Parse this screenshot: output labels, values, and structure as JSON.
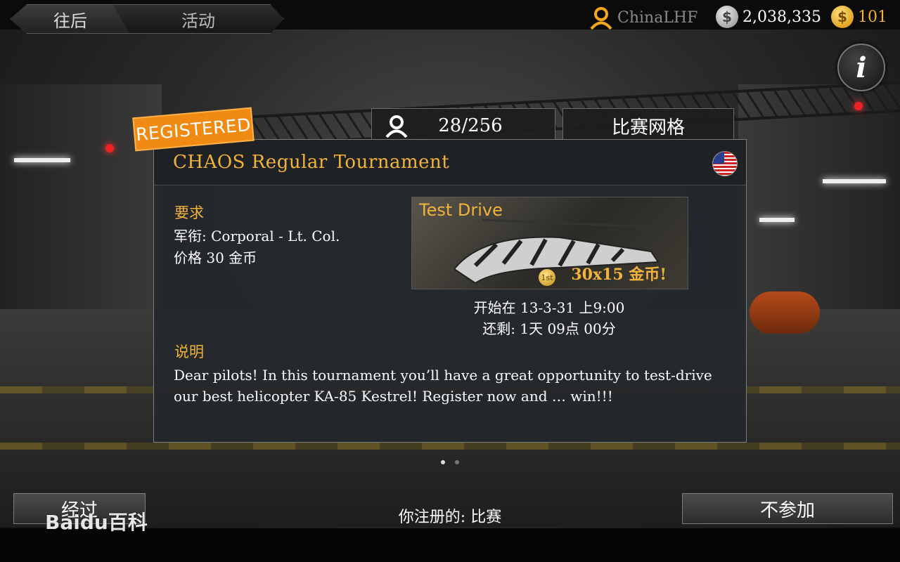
{
  "header": {
    "back_label": "往后",
    "activity_label": "活动",
    "username": "ChinaLHF",
    "silver": "2,038,335",
    "gold": "101",
    "info_glyph": "i"
  },
  "tournament": {
    "participants": "28/256",
    "bracket_label": "比赛网格",
    "registered_badge": "REGISTERED",
    "title": "CHAOS Regular Tournament",
    "requirements_label": "要求",
    "rank_requirement": "军衔: Corporal - Lt. Col.",
    "price": "价格 30 金币",
    "promo_title": "Test Drive",
    "promo_prize": "30x15 金币!",
    "medal_text": "1st",
    "start_time": "开始在 13-3-31 上9:00",
    "remaining": "还剩: 1天 09点 00分",
    "description_label": "说明",
    "description": "Dear pilots! In this tournament you’ll have a great opportunity to test-drive our best helicopter KA-85 Kestrel! Register now and … win!!!"
  },
  "footer": {
    "left_button": "经过",
    "status": "你注册的: 比赛",
    "decline_button": "不参加",
    "watermark": "Baidu百科"
  },
  "colors": {
    "accent": "#f2b33a",
    "badge": "#f08a12",
    "panel": "#24282c"
  },
  "icons": [
    "user-icon",
    "silver-coin-icon",
    "gold-coin-icon",
    "info-icon",
    "participants-icon",
    "us-flag-icon",
    "medal-icon",
    "pager-dots"
  ]
}
